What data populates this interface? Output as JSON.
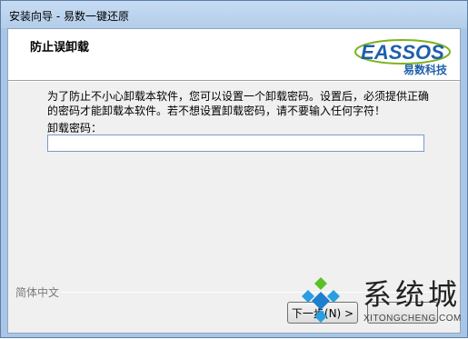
{
  "window": {
    "title": "安装向导 - 易数一键还原"
  },
  "header": {
    "title": "防止误卸载",
    "logo_text": "EASSOS",
    "logo_sub": "易数科技"
  },
  "body": {
    "description": "为了防止不小心卸载本软件，您可以设置一个卸载密码。设置后，必须提供正确的密码才能卸载本软件。若不想设置卸载密码，请不要输入任何字符！",
    "password_label": "卸载密码：",
    "password_value": ""
  },
  "footer": {
    "language": "简体中文",
    "next_label": "下一步(N) >"
  },
  "watermark": {
    "text": "系统城",
    "site": "XITONGCHENG.COM"
  },
  "colors": {
    "logo_blue": "#1f5fa8",
    "logo_green": "#7bb21f",
    "title_bg": "#b9d1ea"
  }
}
